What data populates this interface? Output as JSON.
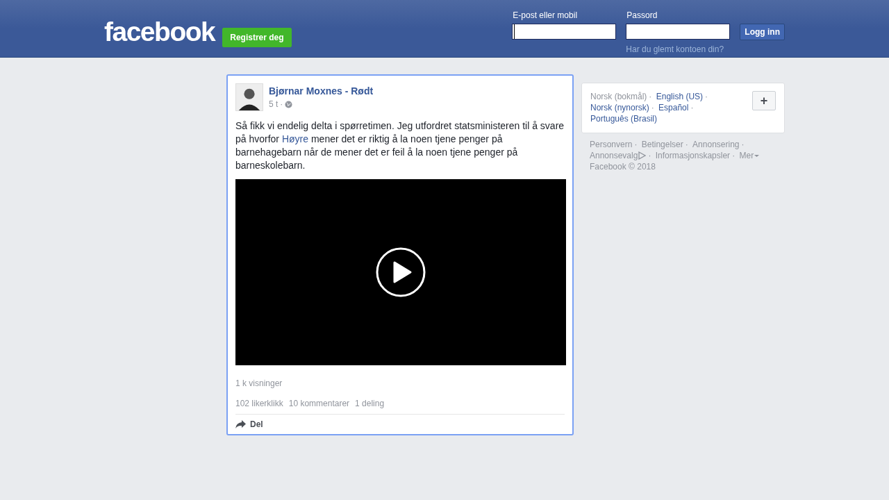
{
  "header": {
    "logo": "facebook",
    "register_button": "Registrer deg",
    "email": {
      "label": "E-post eller mobil",
      "focused": true
    },
    "password": {
      "label": "Passord"
    },
    "login_button": "Logg inn",
    "forgot_link": "Har du glemt kontoen din?"
  },
  "post": {
    "author": "Bjørnar Moxnes - Rødt",
    "time": "5 t",
    "time_separator": "·",
    "text": [
      {
        "kind": "text",
        "text": "Så fikk vi endelig delta i spørretimen. Jeg utfordret statsministeren til å svare på hvorfor "
      },
      {
        "kind": "link",
        "text": "Høyre"
      },
      {
        "kind": "text",
        "text": " mener det er riktig å la noen tjene penger på barnehagebarn når de mener det er feil å la noen tjene penger på barneskolebarn."
      }
    ],
    "video": {
      "kind": "video"
    },
    "views": "1 k visninger",
    "stats": [
      "102 likerklikk",
      "10 kommentarer",
      "1 deling"
    ],
    "share_button": "Del"
  },
  "languages": [
    {
      "label": "Norsk (bokmål)",
      "selected": true,
      "separator": "·"
    },
    {
      "label": "English (US)",
      "selected": false,
      "separator": "·"
    },
    {
      "label": "Norsk (nynorsk)",
      "selected": false,
      "separator": "·"
    },
    {
      "label": "Español",
      "selected": false,
      "separator": "·"
    },
    {
      "label": "Português (Brasil)",
      "selected": false
    }
  ],
  "language_add_button": "+",
  "footer": {
    "links": [
      {
        "label": "Personvern",
        "separator": "·"
      },
      {
        "label": "Betingelser",
        "separator": "·"
      },
      {
        "label": "Annonsering",
        "separator": "·"
      },
      {
        "label": "Annonsevalg",
        "kind": "adchoices",
        "separator": "·"
      },
      {
        "label": "Informasjonskapsler",
        "separator": "·"
      },
      {
        "label": "Mer",
        "kind": "more"
      }
    ],
    "copyright": "Facebook © 2018"
  }
}
